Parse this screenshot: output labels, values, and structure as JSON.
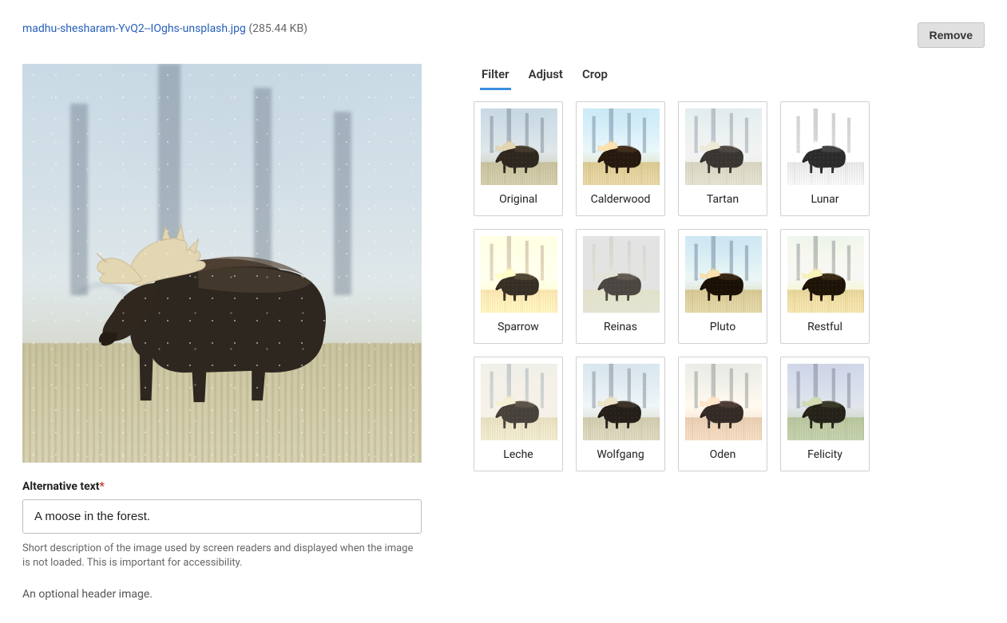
{
  "file": {
    "name": "madhu-shesharam-YvQ2--IOghs-unsplash.jpg",
    "size": "(285.44 KB)"
  },
  "buttons": {
    "remove": "Remove"
  },
  "alt_text": {
    "label": "Alternative text",
    "required_marker": "*",
    "value": "A moose in the forest.",
    "help": "Short description of the image used by screen readers and displayed when the image is not loaded. This is important for accessibility."
  },
  "caption": "An optional header image.",
  "tabs": {
    "filter": "Filter",
    "adjust": "Adjust",
    "crop": "Crop",
    "active": "filter"
  },
  "filters": [
    {
      "name": "Original",
      "css": "none"
    },
    {
      "name": "Calderwood",
      "css": "saturate(1.4) contrast(1.15) hue-rotate(-6deg)"
    },
    {
      "name": "Tartan",
      "css": "brightness(1.15) saturate(0.5) contrast(0.9)"
    },
    {
      "name": "Lunar",
      "css": "grayscale(1) brightness(1.18) contrast(1.05)"
    },
    {
      "name": "Sparrow",
      "css": "sepia(0.55) brightness(1.08) saturate(1.1)"
    },
    {
      "name": "Reinas",
      "css": "sepia(0.35) brightness(1.28) contrast(0.78) saturate(0.7)"
    },
    {
      "name": "Pluto",
      "css": "contrast(1.25) saturate(1.25) brightness(0.96) hue-rotate(-4deg)"
    },
    {
      "name": "Restful",
      "css": "sepia(0.25) contrast(1.25) saturate(1.2) brightness(0.97)"
    },
    {
      "name": "Leche",
      "css": "brightness(1.22) contrast(0.82) sepia(0.18) saturate(0.75)"
    },
    {
      "name": "Wolfgang",
      "css": "saturate(0.7) contrast(1.1) brightness(1.02)"
    },
    {
      "name": "Oden",
      "css": "sepia(0.25) hue-rotate(-18deg) saturate(0.9) brightness(1.04)"
    },
    {
      "name": "Felicity",
      "css": "hue-rotate(25deg) saturate(0.95) brightness(0.98) contrast(1.05)"
    }
  ]
}
